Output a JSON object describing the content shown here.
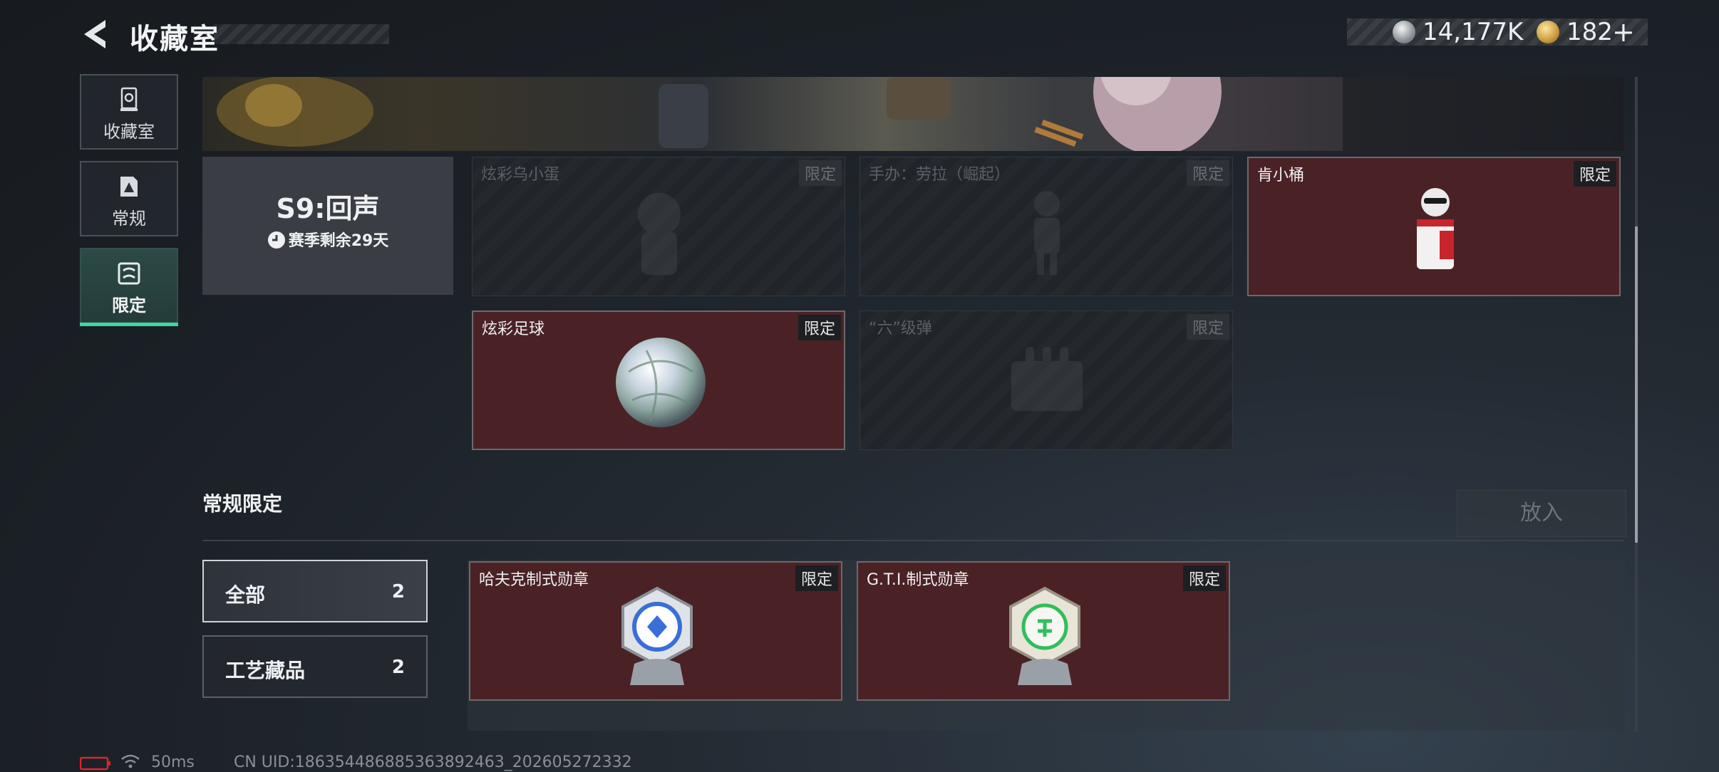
{
  "header": {
    "title": "收藏室",
    "currency": [
      {
        "icon": "silver-coin-icon",
        "value": "14,177K"
      },
      {
        "icon": "gold-coin-icon",
        "value": "182"
      }
    ],
    "add_symbol": "+"
  },
  "sidebar": {
    "items": [
      {
        "label": "收藏室",
        "icon": "trophy-cabinet-icon",
        "active": false
      },
      {
        "label": "常规",
        "icon": "standard-collection-icon",
        "active": false
      },
      {
        "label": "限定",
        "icon": "limited-collection-icon",
        "active": true
      }
    ]
  },
  "season": {
    "title": "S9:回声",
    "remaining": "赛季剩余29天"
  },
  "season_items": [
    {
      "name": "炫彩乌小蛋",
      "tag": "限定",
      "owned": false
    },
    {
      "name": "手办：劳拉（崛起）",
      "tag": "限定",
      "owned": false
    },
    {
      "name": "肯小桶",
      "tag": "限定",
      "owned": true
    },
    {
      "name": "炫彩足球",
      "tag": "限定",
      "owned": true
    },
    {
      "name": "“六”级弹",
      "tag": "限定",
      "owned": false
    }
  ],
  "regular_limited": {
    "title": "常规限定",
    "put_button": "放入",
    "filters": [
      {
        "label": "全部",
        "count": "2",
        "selected": true
      },
      {
        "label": "工艺藏品",
        "count": "2",
        "selected": false
      }
    ],
    "items": [
      {
        "name": "哈夫克制式勋章",
        "tag": "限定",
        "accent": "#3a6fd8"
      },
      {
        "name": "G.T.I.制式勋章",
        "tag": "限定",
        "accent": "#2fbf5a"
      }
    ]
  },
  "status": {
    "ping": "50ms",
    "uid": "CN UID:1863544868853638924​63_202605272332"
  },
  "colors": {
    "accent_green": "#3ed7a0",
    "owned_card": "#4a2226"
  }
}
